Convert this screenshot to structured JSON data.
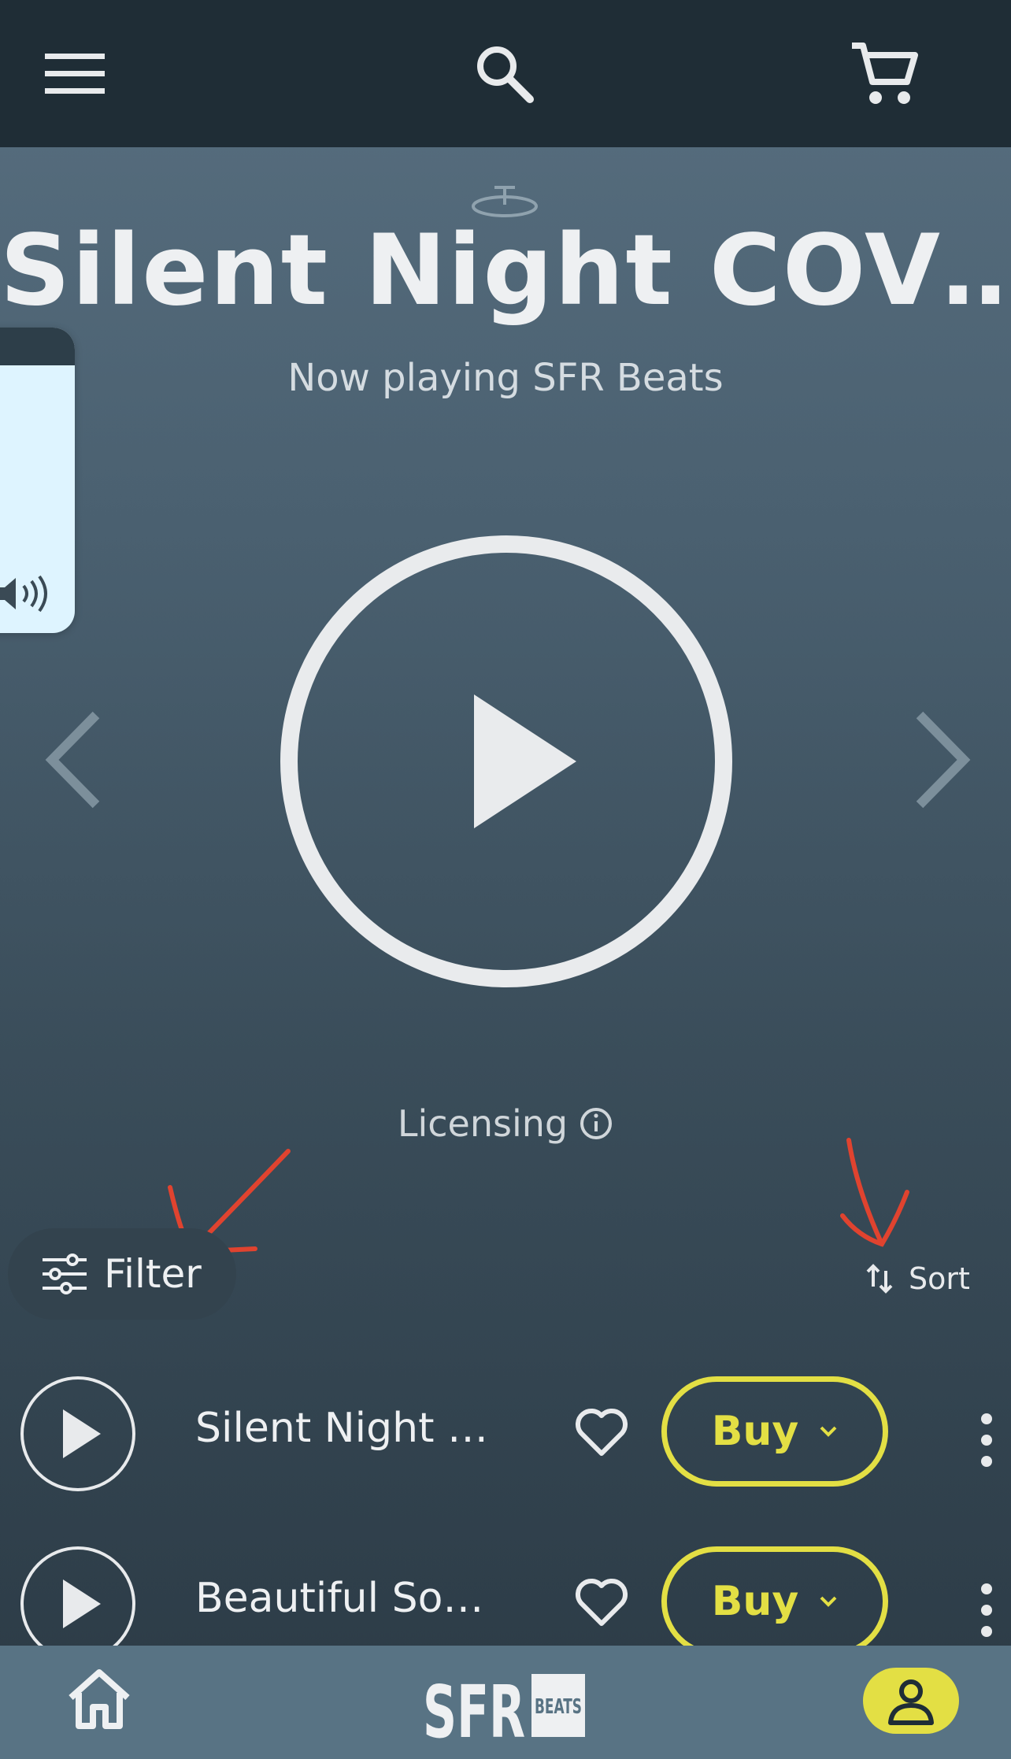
{
  "header": {
    "menu_icon": "hamburger-icon",
    "search_icon": "search-icon",
    "cart_icon": "cart-icon"
  },
  "hero": {
    "title": "Silent Night COV…",
    "subtitle": "Now playing SFR Beats",
    "play_icon": "play-icon",
    "prev_icon": "chevron-left-icon",
    "next_icon": "chevron-right-icon"
  },
  "side_panel": {
    "icon": "volume-icon"
  },
  "licensing": {
    "label": "Licensing",
    "icon": "info-icon"
  },
  "controls": {
    "filter_label": "Filter",
    "sort_label": "Sort"
  },
  "tracks": [
    {
      "title": "Silent Night …",
      "buy_label": "Buy"
    },
    {
      "title": "Beautiful So…",
      "buy_label": "Buy"
    }
  ],
  "bottom_nav": {
    "home_icon": "home-icon",
    "brand_main": "SFR",
    "brand_sub": "BEATS",
    "profile_icon": "profile-icon"
  },
  "colors": {
    "accent": "#e3df44",
    "topbar": "#1f2d36",
    "bottombar": "#587384",
    "annotation": "#e0432f"
  }
}
